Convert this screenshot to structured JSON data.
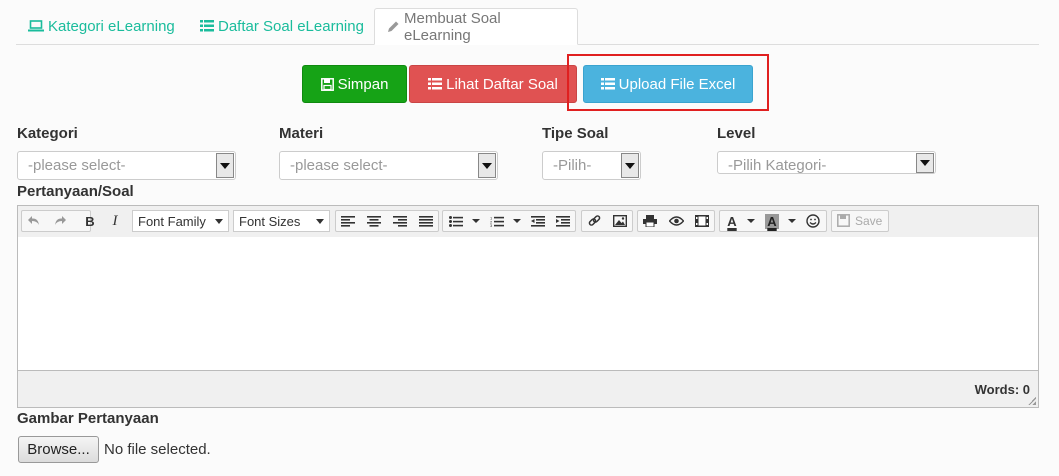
{
  "tabs": [
    {
      "label": "Kategori eLearning",
      "icon": "laptop-icon"
    },
    {
      "label": "Daftar Soal eLearning",
      "icon": "list-icon"
    },
    {
      "label": "Membuat Soal eLearning",
      "icon": "pencil-icon",
      "active": true
    }
  ],
  "actions": {
    "save_label": "Simpan",
    "list_label": "Lihat Daftar Soal",
    "upload_label": "Upload File Excel"
  },
  "form": {
    "kategori": {
      "label": "Kategori",
      "value": "-please select-"
    },
    "materi": {
      "label": "Materi",
      "value": "-please select-"
    },
    "tipe": {
      "label": "Tipe Soal",
      "value": "-Pilih-"
    },
    "level": {
      "label": "Level",
      "value": "-Pilih Kategori-"
    },
    "question_label": "Pertanyaan/Soal",
    "image_label": "Gambar Pertanyaan",
    "browse_label": "Browse...",
    "file_status": "No file selected."
  },
  "editor": {
    "font_family": "Font Family",
    "font_sizes": "Font Sizes",
    "save_label": "Save",
    "words": "Words: 0"
  },
  "colors": {
    "accent": "#1abc9c",
    "save": "#16a316",
    "list": "#e05252",
    "upload": "#4bb3de",
    "highlight": "#e02020"
  }
}
